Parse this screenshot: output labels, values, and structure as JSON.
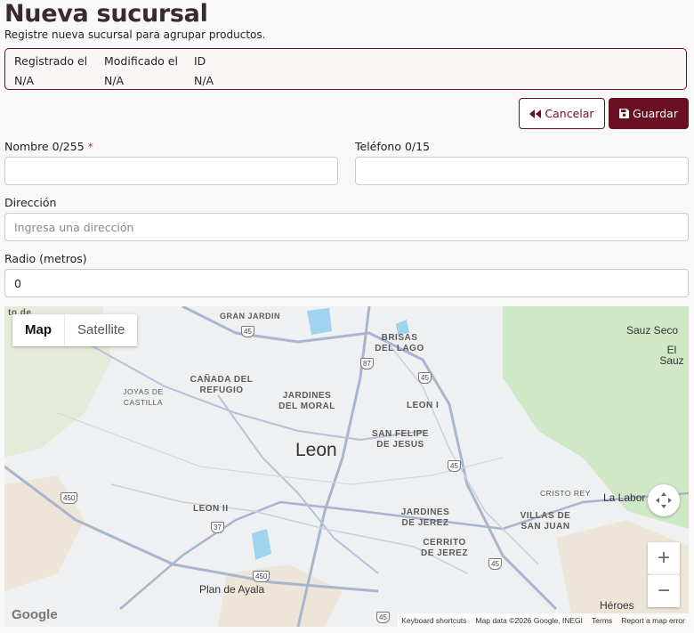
{
  "page": {
    "title": "Nueva sucursal",
    "subtitle": "Registre nueva sucursal para agrupar productos."
  },
  "meta": [
    {
      "label": "Registrado el",
      "value": "N/A"
    },
    {
      "label": "Modificado el",
      "value": "N/A"
    },
    {
      "label": "ID",
      "value": "N/A"
    }
  ],
  "actions": {
    "cancel_label": "Cancelar",
    "save_label": "Guardar"
  },
  "form": {
    "name_label": "Nombre 0/255",
    "name_required": "*",
    "name_value": "",
    "phone_label": "Teléfono 0/15",
    "phone_value": "",
    "address_label": "Dirección",
    "address_placeholder": "Ingresa una dirección",
    "radius_label": "Radio (metros)",
    "radius_value": "0"
  },
  "map": {
    "type_map": "Map",
    "type_satellite": "Satellite",
    "logo": "Google",
    "city": "Leon",
    "places": [
      "GRAN JARDIN",
      "BRISAS DEL LAGO",
      "CAÑADA DEL REFUGIO",
      "JOYAS DE CASTILLA",
      "JARDINES DEL MORAL",
      "LEON I",
      "SAN FELIPE DE JESUS",
      "CRISTO REY",
      "LEON II",
      "JARDINES DE JEREZ",
      "VILLAS DE SAN JUAN",
      "CERRITO DE JEREZ",
      "Plan de Ayala",
      "Sauz Seco",
      "El Sauz",
      "La Labor",
      "Héroes",
      "to de"
    ],
    "shields": [
      "45",
      "87",
      "45",
      "45",
      "450",
      "37",
      "450",
      "45",
      "45",
      "45"
    ],
    "attribution": {
      "shortcuts": "Keyboard shortcuts",
      "data": "Map data ©2026 Google, INEGI",
      "terms": "Terms",
      "report": "Report a map error"
    },
    "colors": {
      "park": "#cfe8c6",
      "water": "#9fd3ee",
      "road": "#a9b4cf"
    }
  },
  "colors": {
    "accent": "#6b0f24"
  }
}
